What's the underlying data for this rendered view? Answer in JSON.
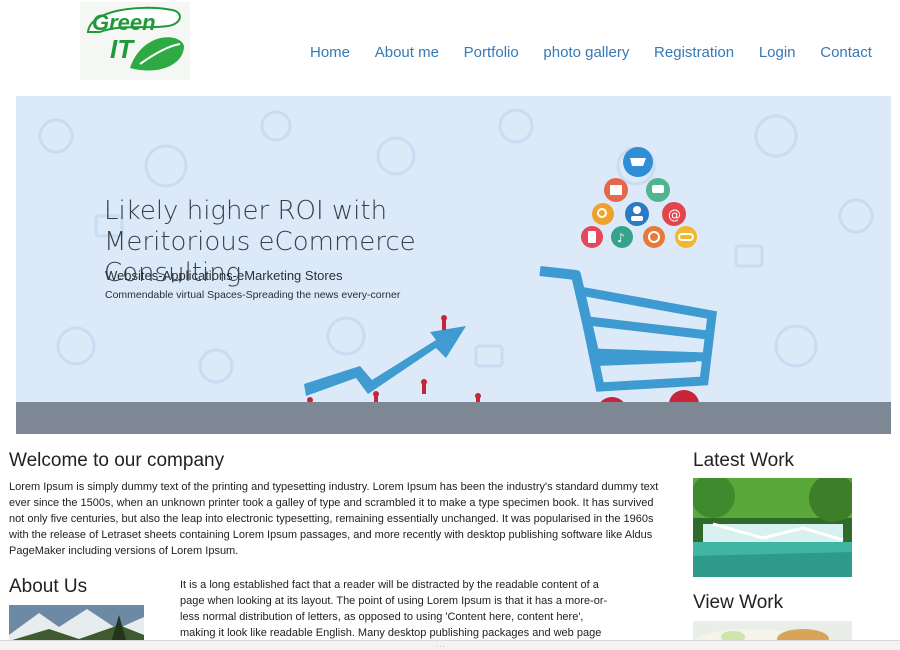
{
  "logo": {
    "text_line1": "Green",
    "text_line2": "IT"
  },
  "nav": {
    "items": [
      {
        "label": "Home"
      },
      {
        "label": "About me"
      },
      {
        "label": "Portfolio"
      },
      {
        "label": "photo gallery"
      },
      {
        "label": "Registration"
      },
      {
        "label": "Login"
      },
      {
        "label": "Contact"
      }
    ]
  },
  "banner": {
    "headline": "Likely higher ROI with Meritorious eCommerce Consulting",
    "subtitle": "Websites-Applications-eMarketing Stores",
    "tagline": "Commendable virtual Spaces-Spreading the news every-corner"
  },
  "welcome": {
    "title": "Welcome to our company",
    "text": "Lorem Ipsum is simply dummy text of the printing and typesetting industry. Lorem Ipsum has been the industry's standard dummy text ever since the 1500s, when an unknown printer took a galley of type and scrambled it to make a type specimen book. It has survived not only five centuries, but also the leap into electronic typesetting, remaining essentially unchanged. It was popularised in the 1960s with the release of Letraset sheets containing Lorem Ipsum passages, and more recently with desktop publishing software like Aldus PageMaker including versions of Lorem Ipsum."
  },
  "about": {
    "title": "About Us",
    "text": "It is a long established fact that a reader will be distracted by the readable content of a page when looking at its layout. The point of using Lorem Ipsum is that it has a more-or-less normal distribution of letters, as opposed to using 'Content here, content here', making it look like readable English. Many desktop publishing packages and web page editors now"
  },
  "latest_work": {
    "title": "Latest Work"
  },
  "view_work": {
    "title": "View Work"
  },
  "colors": {
    "nav_link": "#3579b5",
    "logo_green": "#1f9a3a",
    "cart_blue": "#3d9bd1",
    "arrow_blue": "#3f9bd0"
  },
  "icons": [
    "cart-icon",
    "calendar-icon",
    "chat-icon",
    "search-icon",
    "user-icon",
    "at-icon",
    "mobile-icon",
    "music-icon",
    "target-icon",
    "link-icon"
  ]
}
